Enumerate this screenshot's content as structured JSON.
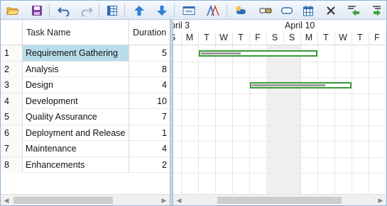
{
  "toolbar": {
    "buttons": [
      {
        "name": "open-icon",
        "color": "#e3a43a"
      },
      {
        "name": "save-icon",
        "color": "#7b3f9e"
      },
      {
        "name": "undo-icon",
        "color": "#2f6db5"
      },
      {
        "name": "redo-icon",
        "color": "#9fb4cc"
      },
      {
        "name": "grid-columns-icon",
        "color": "#2f6db5"
      },
      {
        "name": "move-up-icon",
        "color": "#2f7fd6"
      },
      {
        "name": "move-down-icon",
        "color": "#2f7fd6"
      },
      {
        "name": "task-info-icon",
        "color": "#2f6db5"
      },
      {
        "name": "critical-path-icon",
        "color": "#2f6db5"
      },
      {
        "name": "add-task-icon",
        "color": "#2f6db5"
      },
      {
        "name": "link-tasks-icon",
        "color": "#555555"
      },
      {
        "name": "split-task-icon",
        "color": "#2f6db5"
      },
      {
        "name": "calendar-icon",
        "color": "#2f6db5"
      },
      {
        "name": "delete-icon",
        "color": "#333333"
      },
      {
        "name": "outdent-icon",
        "color": "#3aa23a"
      },
      {
        "name": "indent-icon",
        "color": "#3aa23a"
      }
    ]
  },
  "grid": {
    "columns": {
      "id": "",
      "name": "Task Name",
      "duration": "Duration"
    },
    "rows": [
      {
        "id": "1",
        "name": "Requirement Gathering",
        "duration": "5"
      },
      {
        "id": "2",
        "name": "Analysis",
        "duration": "8"
      },
      {
        "id": "3",
        "name": "Design",
        "duration": "4"
      },
      {
        "id": "4",
        "name": "Development",
        "duration": "10"
      },
      {
        "id": "5",
        "name": "Quality Assurance",
        "duration": "7"
      },
      {
        "id": "6",
        "name": "Deployment and Release",
        "duration": "1"
      },
      {
        "id": "7",
        "name": "Maintenance",
        "duration": "4"
      },
      {
        "id": "8",
        "name": "Enhancements",
        "duration": "2"
      }
    ],
    "selected_row": 1
  },
  "timeline": {
    "months": [
      "pril 3",
      "April 10"
    ],
    "days": [
      "S",
      "M",
      "T",
      "W",
      "T",
      "F",
      "S",
      "S",
      "M",
      "T",
      "W",
      "T",
      "F"
    ],
    "accent": "#3a9a3a",
    "weekend_color": "#efefef"
  }
}
